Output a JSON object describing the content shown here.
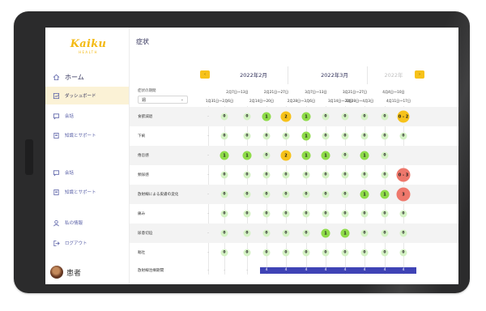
{
  "app": {
    "logo": "Kaiku",
    "logo_sub": "HEALTH",
    "patient_name": "患者"
  },
  "sidebar": {
    "items": [
      {
        "label": "ホーム",
        "icon": "home-icon"
      },
      {
        "label": "ダッシュボード",
        "icon": "dashboard-icon"
      },
      {
        "label": "会話",
        "icon": "chat-icon"
      },
      {
        "label": "知識とサポート",
        "icon": "book-icon"
      },
      {
        "label": "会話",
        "icon": "chat-icon"
      },
      {
        "label": "知識とサポート",
        "icon": "book-icon"
      },
      {
        "label": "私の情報",
        "icon": "user-icon"
      },
      {
        "label": "ログアウト",
        "icon": "logout-icon"
      }
    ]
  },
  "page": {
    "title": "症状",
    "prev_label": "‹",
    "next_label": "›",
    "months": [
      "2022年2月",
      "2022年3月",
      "2022年"
    ],
    "period_label": "症状の期間",
    "period_value": "週",
    "weeks_top": [
      "2月7日〜13日",
      "2月21日〜27日",
      "3月7日〜13日",
      "3月21日〜27日",
      "4月4日〜10日"
    ],
    "weeks_bottom": [
      "1月31日〜2月6日",
      "2月14日〜20日",
      "2月28日〜3月6日",
      "3月14日〜20日",
      "3月28日〜4月3日",
      "4月11日〜17日"
    ]
  },
  "accent": "#f7c21a",
  "treatment_color": "#3f43b5",
  "symptoms": [
    {
      "label": "食欲減退",
      "values": [
        "-",
        "0",
        "0",
        "1",
        "2",
        "1",
        "0",
        "0",
        "0",
        "0",
        "0 - 2"
      ]
    },
    {
      "label": "下痢",
      "values": [
        "-",
        "0",
        "0",
        "0",
        "0",
        "1",
        "0",
        "0",
        "0",
        "0",
        "0"
      ]
    },
    {
      "label": "倦怠感",
      "values": [
        "-",
        "1",
        "1",
        "0",
        "2",
        "1",
        "1",
        "0",
        "1",
        "0",
        ""
      ]
    },
    {
      "label": "頻尿感",
      "values": [
        "-",
        "0",
        "0",
        "0",
        "0",
        "0",
        "0",
        "0",
        "0",
        "0",
        "0 - 3"
      ]
    },
    {
      "label": "放射線による皮膚の変化",
      "values": [
        "-",
        "0",
        "0",
        "0",
        "0",
        "0",
        "0",
        "0",
        "1",
        "1",
        "3"
      ]
    },
    {
      "label": "痛み",
      "values": [
        "-",
        "0",
        "0",
        "0",
        "0",
        "0",
        "0",
        "0",
        "0",
        "0",
        "0"
      ]
    },
    {
      "label": "尿意切迫",
      "values": [
        "-",
        "0",
        "0",
        "0",
        "0",
        "0",
        "1",
        "1",
        "0",
        "0",
        "0"
      ]
    },
    {
      "label": "嘔吐",
      "values": [
        "-",
        "0",
        "0",
        "0",
        "0",
        "0",
        "0",
        "0",
        "0",
        "0",
        "0"
      ]
    }
  ],
  "treatment": {
    "label": "放射線治療期間",
    "values": [
      "-",
      "-",
      "-",
      "4",
      "4",
      "4",
      "4",
      "4",
      "4",
      "4",
      "4"
    ]
  }
}
